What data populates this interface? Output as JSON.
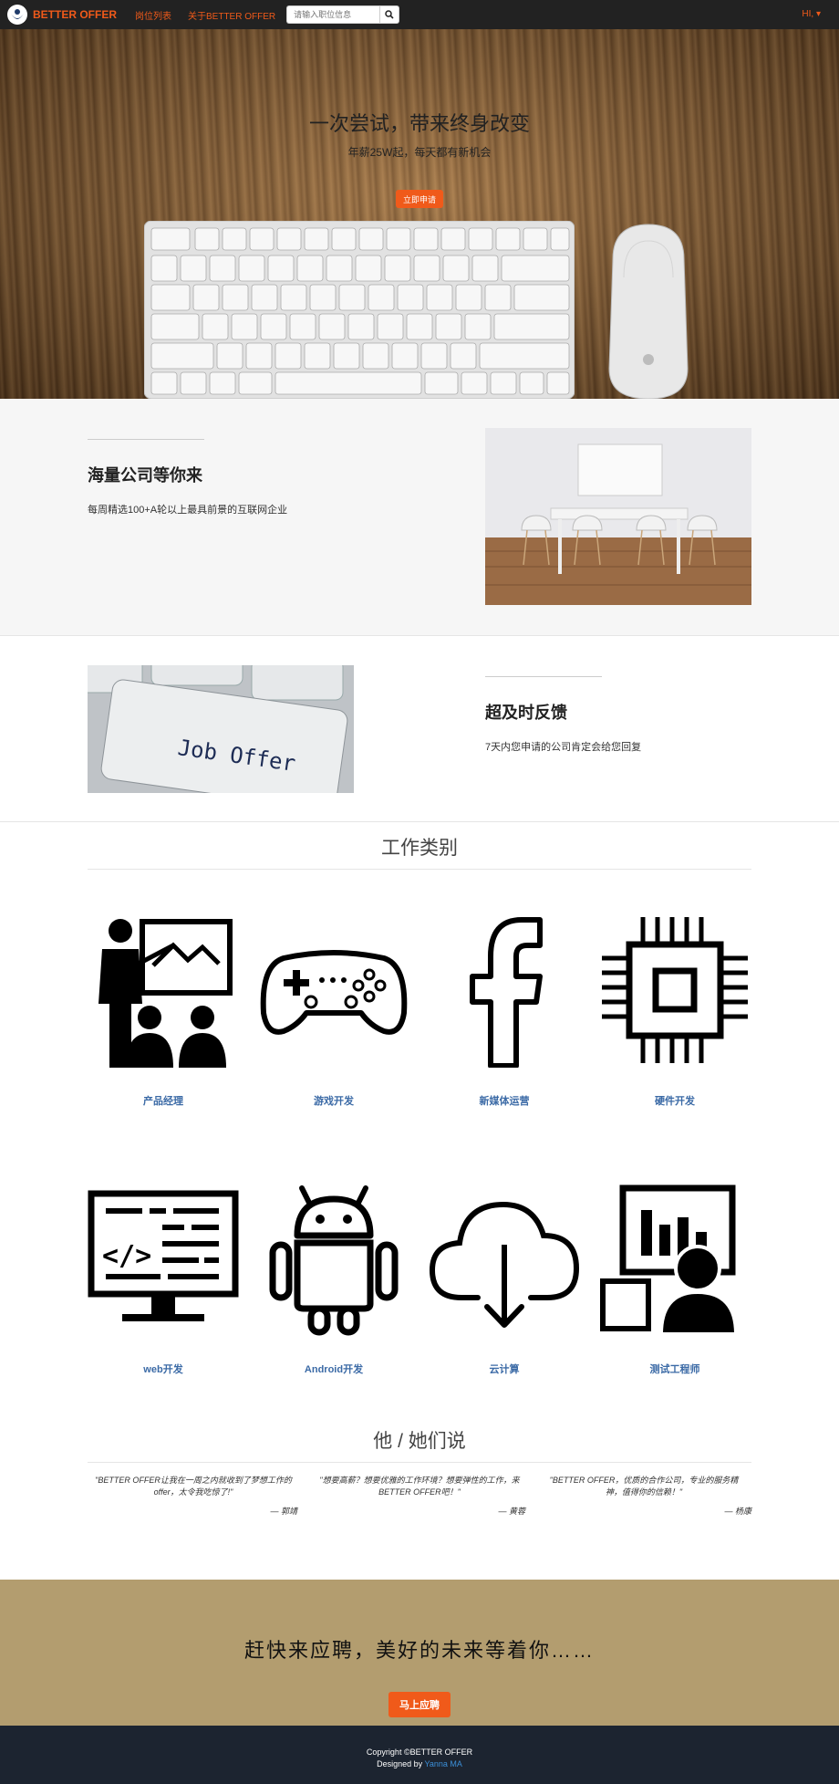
{
  "navbar": {
    "brand": "BETTER OFFER",
    "links": [
      "岗位列表",
      "关于BETTER OFFER"
    ],
    "search_placeholder": "请输入职位信息",
    "user_menu": "HI, ▾"
  },
  "hero": {
    "title": "一次尝试，带来终身改变",
    "subtitle": "年薪25W起，每天都有新机会",
    "button": "立即申请"
  },
  "features": [
    {
      "title": "海量公司等你来",
      "text": "每周精选100+A轮以上最具前景的互联网企业"
    },
    {
      "title": "超及时反馈",
      "text": "7天内您申请的公司肯定会给您回复"
    }
  ],
  "job_offer_image_text": "Job Offer",
  "categories_title": "工作类别",
  "categories": [
    {
      "label": "产品经理",
      "icon": "presentation-icon"
    },
    {
      "label": "游戏开发",
      "icon": "gamepad-icon"
    },
    {
      "label": "新媒体运营",
      "icon": "facebook-icon"
    },
    {
      "label": "硬件开发",
      "icon": "chip-icon"
    },
    {
      "label": "web开发",
      "icon": "code-monitor-icon"
    },
    {
      "label": "Android开发",
      "icon": "android-icon"
    },
    {
      "label": "云计算",
      "icon": "cloud-download-icon"
    },
    {
      "label": "测试工程师",
      "icon": "analyst-icon"
    }
  ],
  "testimonials_title": "他 / 她们说",
  "testimonials": [
    {
      "quote": "\"BETTER OFFER让我在一周之内就收到了梦想工作的offer，太令我吃惊了!\"",
      "author": "— 郭靖"
    },
    {
      "quote": "\"想要高薪？想要优雅的工作环境？想要弹性的工作，来BETTER OFFER吧！\"",
      "author": "— 黄蓉"
    },
    {
      "quote": "\"BETTER OFFER，优质的合作公司，专业的服务精神，值得你的信赖！\"",
      "author": "— 杨康"
    }
  ],
  "cta": {
    "title": "赶快来应聘，美好的未来等着你……",
    "button": "马上应聘"
  },
  "footer": {
    "copyright": "Copyright ©BETTER OFFER",
    "designed_by": "Designed by",
    "designer": "Yanna MA"
  },
  "colors": {
    "accent": "#f05a1a",
    "nav_bg": "#222222",
    "link_blue": "#3b6aa6",
    "cta_bg": "#b39d6f",
    "footer_bg": "#1c2430"
  }
}
